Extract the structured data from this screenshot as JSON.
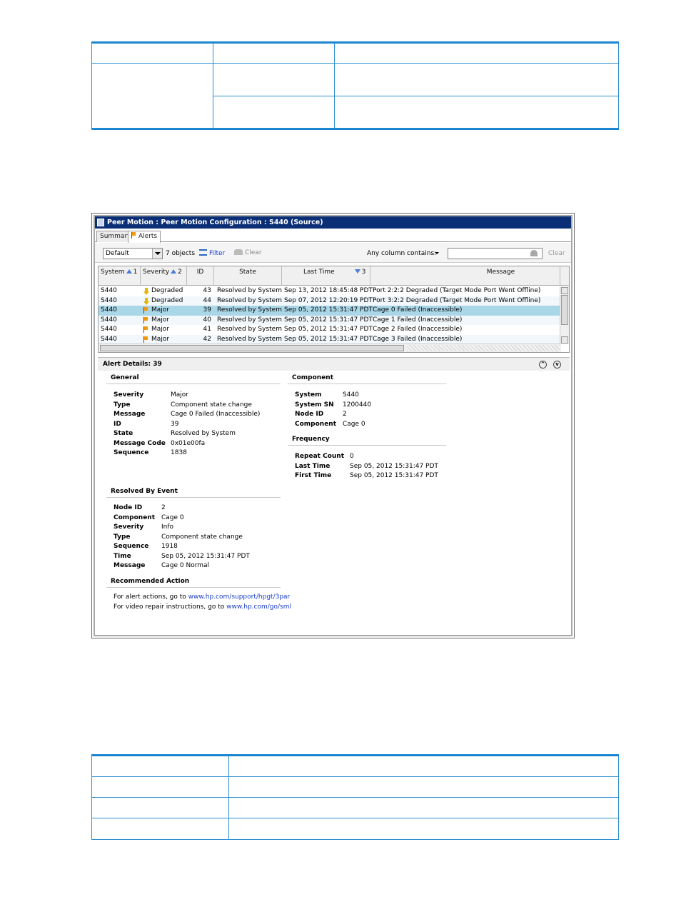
{
  "window": {
    "title": "Peer Motion : Peer Motion Configuration : S440 (Source)"
  },
  "tabs": [
    {
      "label": "Summary"
    },
    {
      "label": "Alerts"
    }
  ],
  "toolbar": {
    "view": "Default",
    "object_count": "7 objects",
    "filter_label": "Filter",
    "clear_label": "Clear",
    "contains_label": "Any column contains:",
    "search_value": "",
    "search_clear_label": "Clear"
  },
  "grid": {
    "columns": [
      {
        "label": "System",
        "sort": "1",
        "dir": "up"
      },
      {
        "label": "Severity",
        "sort": "2",
        "dir": "up"
      },
      {
        "label": "ID",
        "sort": "",
        "dir": ""
      },
      {
        "label": "State",
        "sort": "",
        "dir": ""
      },
      {
        "label": "Last Time",
        "sort": "3",
        "dir": "down"
      },
      {
        "label": "Message",
        "sort": "",
        "dir": ""
      }
    ],
    "rows": [
      {
        "system": "S440",
        "severity": "Degraded",
        "icon": "degraded-arrow-icon",
        "id": "43",
        "state": "Resolved by System",
        "last_time": "Sep 13, 2012 18:45:48 PDT",
        "message": "Port 2:2:2 Degraded (Target Mode Port Went Offline)"
      },
      {
        "system": "S440",
        "severity": "Degraded",
        "icon": "degraded-arrow-icon",
        "id": "44",
        "state": "Resolved by System",
        "last_time": "Sep 07, 2012 12:20:19 PDT",
        "message": "Port 3:2:2 Degraded (Target Mode Port Went Offline)"
      },
      {
        "system": "S440",
        "severity": "Major",
        "icon": "major-flag-icon",
        "id": "39",
        "state": "Resolved by System",
        "last_time": "Sep 05, 2012 15:31:47 PDT",
        "message": "Cage 0 Failed (Inaccessible)",
        "selected": true
      },
      {
        "system": "S440",
        "severity": "Major",
        "icon": "major-flag-icon",
        "id": "40",
        "state": "Resolved by System",
        "last_time": "Sep 05, 2012 15:31:47 PDT",
        "message": "Cage 1 Failed (Inaccessible)"
      },
      {
        "system": "S440",
        "severity": "Major",
        "icon": "major-flag-icon",
        "id": "41",
        "state": "Resolved by System",
        "last_time": "Sep 05, 2012 15:31:47 PDT",
        "message": "Cage 2 Failed (Inaccessible)"
      },
      {
        "system": "S440",
        "severity": "Major",
        "icon": "major-flag-icon",
        "id": "42",
        "state": "Resolved by System",
        "last_time": "Sep 05, 2012 15:31:47 PDT",
        "message": "Cage 3 Failed (Inaccessible)"
      }
    ]
  },
  "details": {
    "title": "Alert Details: 39",
    "general": {
      "title": "General",
      "items": [
        {
          "k": "Severity",
          "v": "Major"
        },
        {
          "k": "Type",
          "v": "Component state change"
        },
        {
          "k": "Message",
          "v": "Cage 0 Failed (Inaccessible)"
        },
        {
          "k": "ID",
          "v": "39"
        },
        {
          "k": "State",
          "v": "Resolved by System"
        },
        {
          "k": "Message Code",
          "v": "0x01e00fa"
        },
        {
          "k": "Sequence",
          "v": "1838"
        }
      ]
    },
    "component": {
      "title": "Component",
      "items": [
        {
          "k": "System",
          "v": "S440"
        },
        {
          "k": "System SN",
          "v": "1200440"
        },
        {
          "k": "Node ID",
          "v": "2"
        },
        {
          "k": "Component",
          "v": "Cage 0"
        }
      ]
    },
    "frequency": {
      "title": "Frequency",
      "items": [
        {
          "k": "Repeat Count",
          "v": "0"
        },
        {
          "k": "Last Time",
          "v": "Sep 05, 2012 15:31:47 PDT"
        },
        {
          "k": "First Time",
          "v": "Sep 05, 2012 15:31:47 PDT"
        }
      ]
    },
    "resolved": {
      "title": "Resolved By Event",
      "items": [
        {
          "k": "Node ID",
          "v": "2"
        },
        {
          "k": "Component",
          "v": "Cage 0"
        },
        {
          "k": "Severity",
          "v": "Info"
        },
        {
          "k": "Type",
          "v": "Component state change"
        },
        {
          "k": "Sequence",
          "v": "1918"
        },
        {
          "k": "Time",
          "v": "Sep 05, 2012 15:31:47 PDT"
        },
        {
          "k": "Message",
          "v": "Cage 0 Normal"
        }
      ]
    },
    "recommended": {
      "title": "Recommended Action",
      "line1_text": "For alert actions, go to",
      "line1_link": "www.hp.com/support/hpgt/3par",
      "line2_text": "For video repair instructions, go to",
      "line2_link": "www.hp.com/go/sml"
    }
  }
}
